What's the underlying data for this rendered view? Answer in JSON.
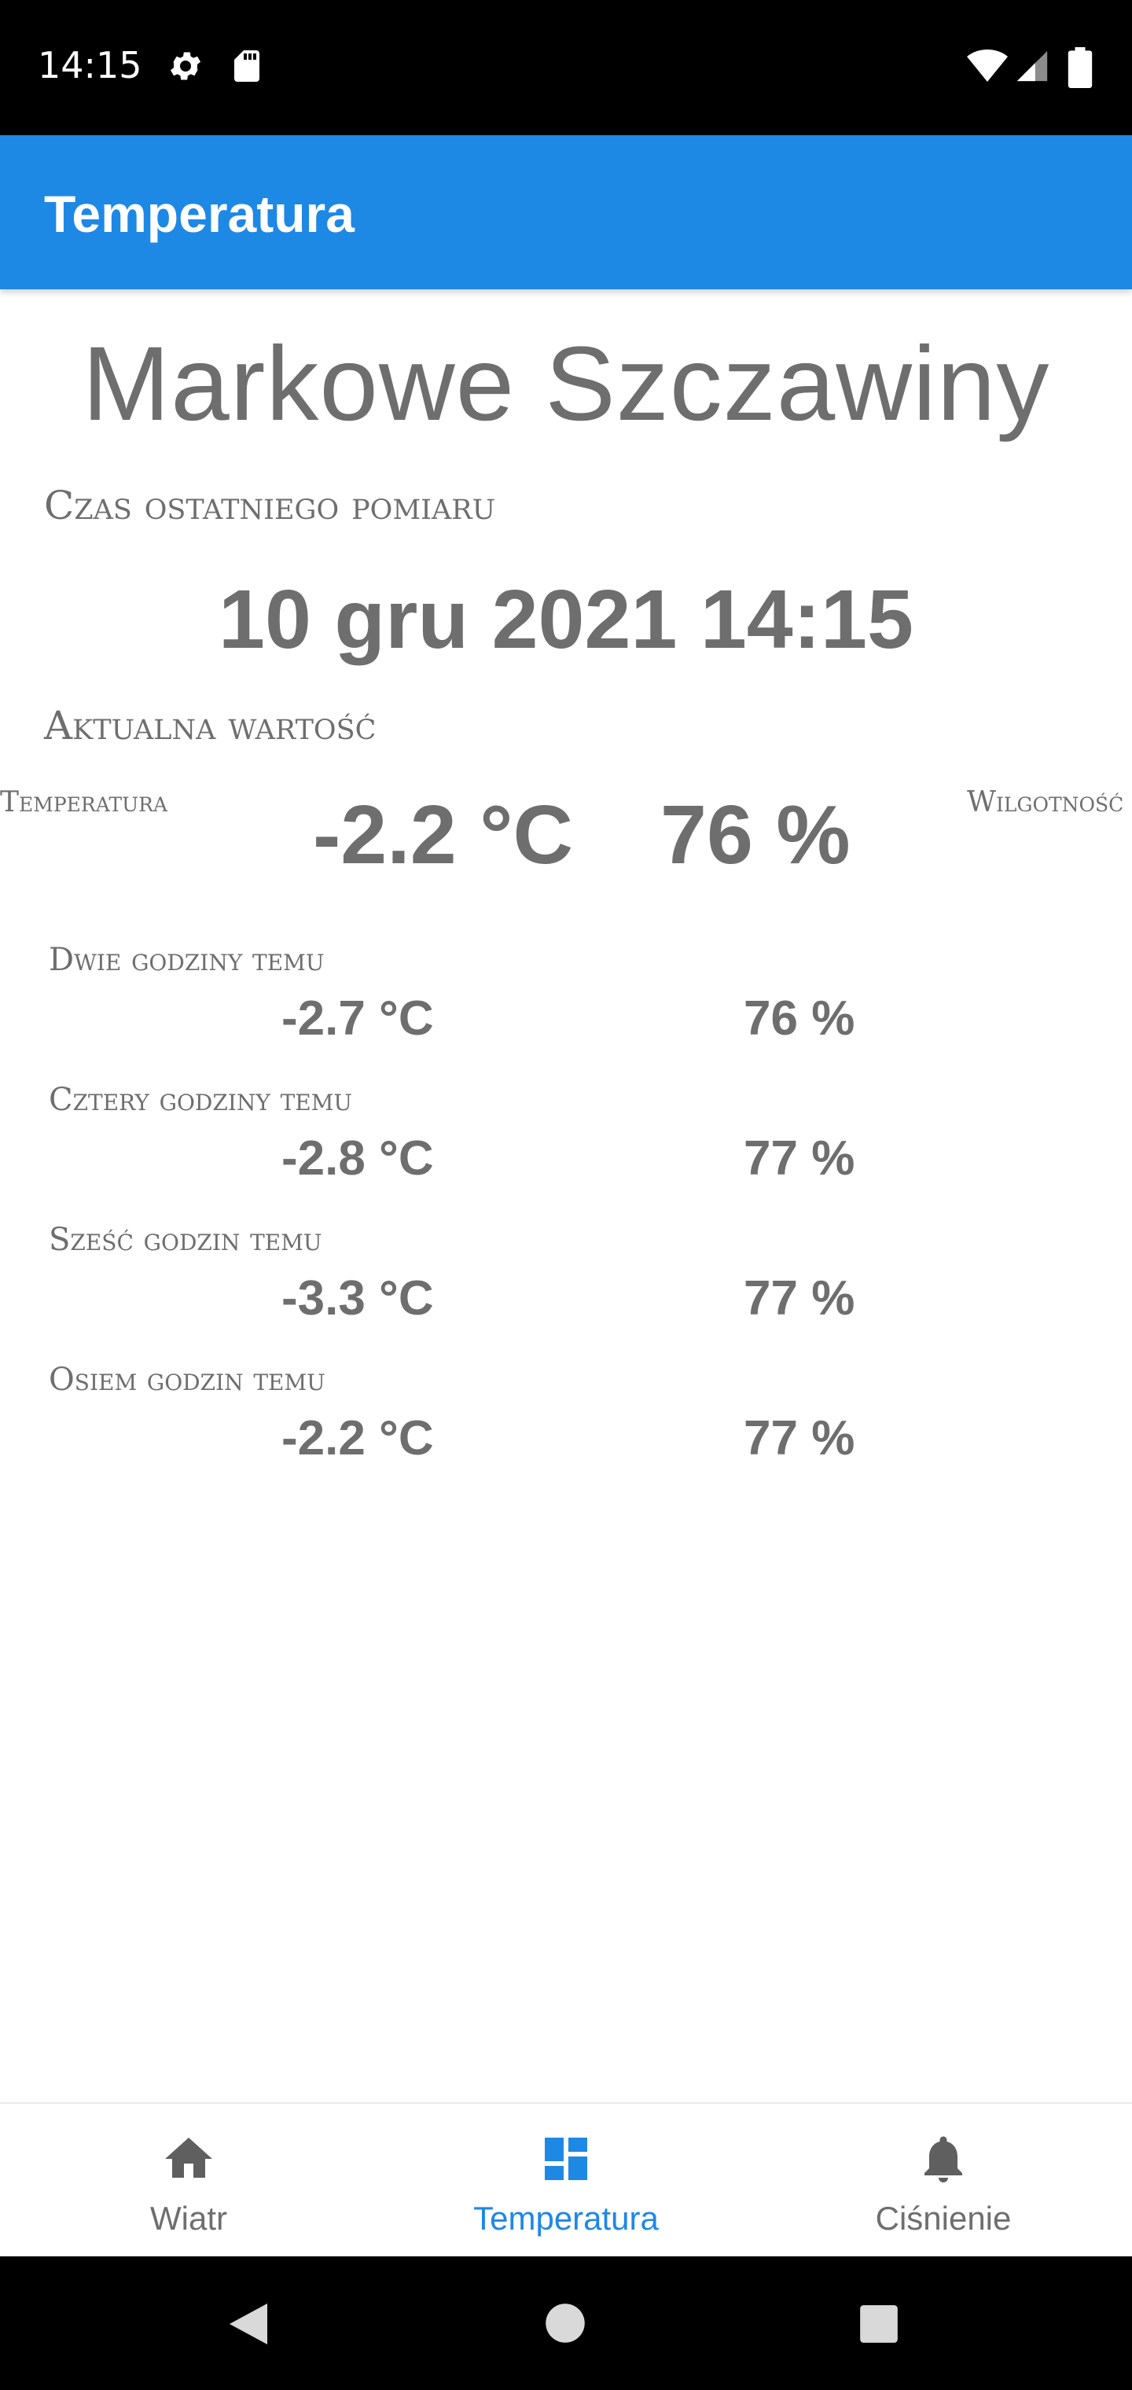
{
  "status_bar": {
    "time": "14:15",
    "icons": [
      "settings-icon",
      "sd-card-icon",
      "wifi-icon",
      "signal-icon",
      "battery-icon"
    ]
  },
  "app_bar": {
    "title": "Temperatura"
  },
  "station": {
    "name": "Markowe Szczawiny"
  },
  "last_measurement": {
    "label": "Czas ostatniego pomiaru",
    "datetime": "10 gru 2021 14:15"
  },
  "current": {
    "label": "Aktualna wartość",
    "temperature_label": "Temperatura",
    "humidity_label": "Wilgotność",
    "temperature": "-2.2 °C",
    "humidity": "76 %"
  },
  "history": [
    {
      "label": "Dwie godziny temu",
      "temperature": "-2.7 °C",
      "humidity": "76 %"
    },
    {
      "label": "Cztery godziny temu",
      "temperature": "-2.8 °C",
      "humidity": "77 %"
    },
    {
      "label": "Sześć godzin temu",
      "temperature": "-3.3 °C",
      "humidity": "77 %"
    },
    {
      "label": "Osiem godzin temu",
      "temperature": "-2.2 °C",
      "humidity": "77 %"
    }
  ],
  "bottom_nav": [
    {
      "label": "Wiatr",
      "icon": "home-icon",
      "active": false
    },
    {
      "label": "Temperatura",
      "icon": "dashboard-icon",
      "active": true
    },
    {
      "label": "Ciśnienie",
      "icon": "bell-icon",
      "active": false
    }
  ],
  "colors": {
    "primary": "#1e88e5",
    "text": "#6e6e6e",
    "inactive_icon": "#5f5f5f"
  }
}
